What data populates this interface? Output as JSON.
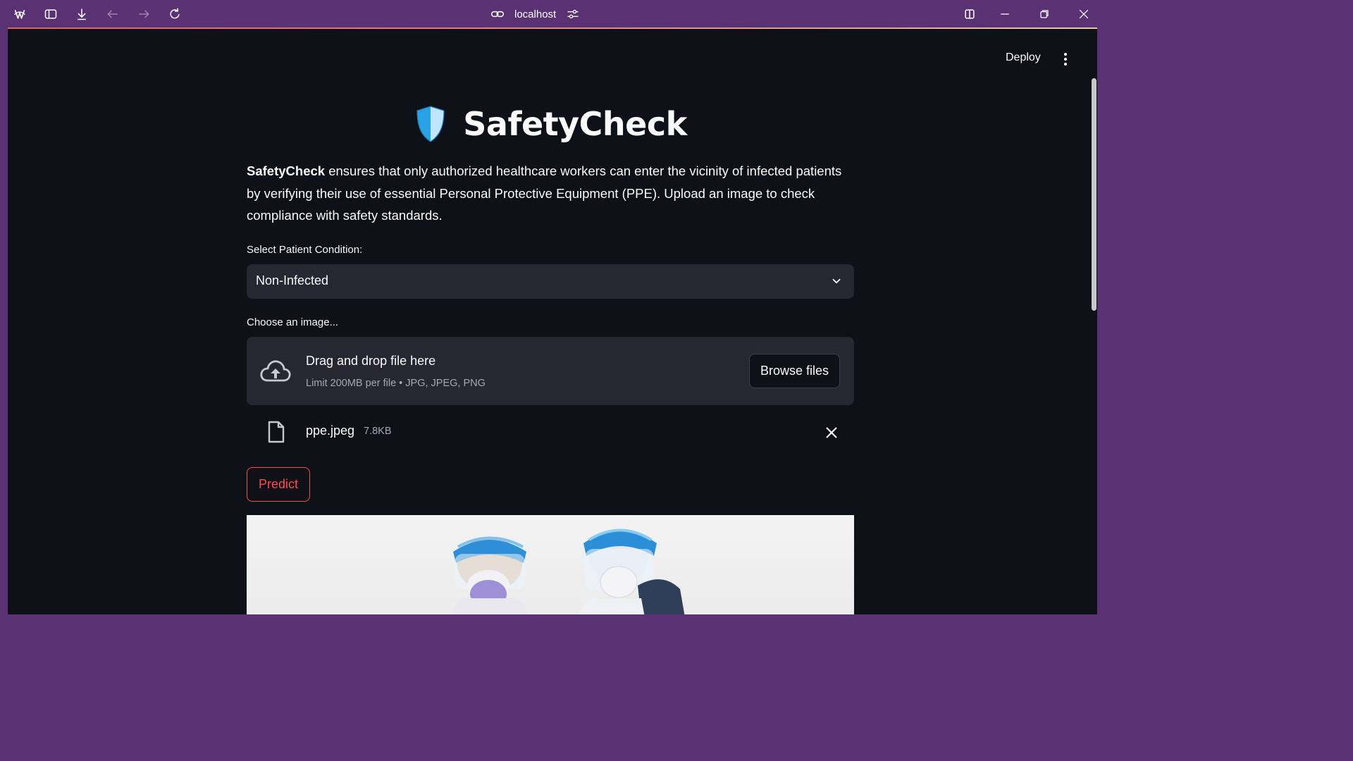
{
  "browser": {
    "url": "localhost",
    "icons": [
      "app-logo-icon",
      "sidebar-toggle-icon",
      "download-icon",
      "back-icon",
      "forward-icon",
      "reload-icon",
      "link-icon",
      "site-settings-icon",
      "split-view-icon",
      "minimize-icon",
      "restore-icon",
      "close-icon"
    ],
    "chrome_color": "#5a3273"
  },
  "header": {
    "deploy_label": "Deploy"
  },
  "page": {
    "title": "SafetyCheck",
    "intro_bold": "SafetyCheck",
    "intro_text": " ensures that only authorized healthcare workers can enter the vicinity of infected patients by verifying their use of essential Personal Protective Equipment (PPE). Upload an image to check compliance with safety standards."
  },
  "condition_select": {
    "label": "Select Patient Condition:",
    "value": "Non-Infected"
  },
  "uploader": {
    "label": "Choose an image...",
    "drop_title": "Drag and drop file here",
    "limit_text": "Limit 200MB per file • JPG, JPEG, PNG",
    "browse_label": "Browse files"
  },
  "uploaded_file": {
    "name": "ppe.jpeg",
    "size": "7.8KB"
  },
  "actions": {
    "predict_label": "Predict"
  },
  "colors": {
    "background": "#0e1117",
    "widget_bg": "#262730",
    "text": "#fafafa",
    "muted": "#a3a8b4",
    "primary": "#ff4b4b",
    "shield_blue": "#2aa3e6"
  }
}
